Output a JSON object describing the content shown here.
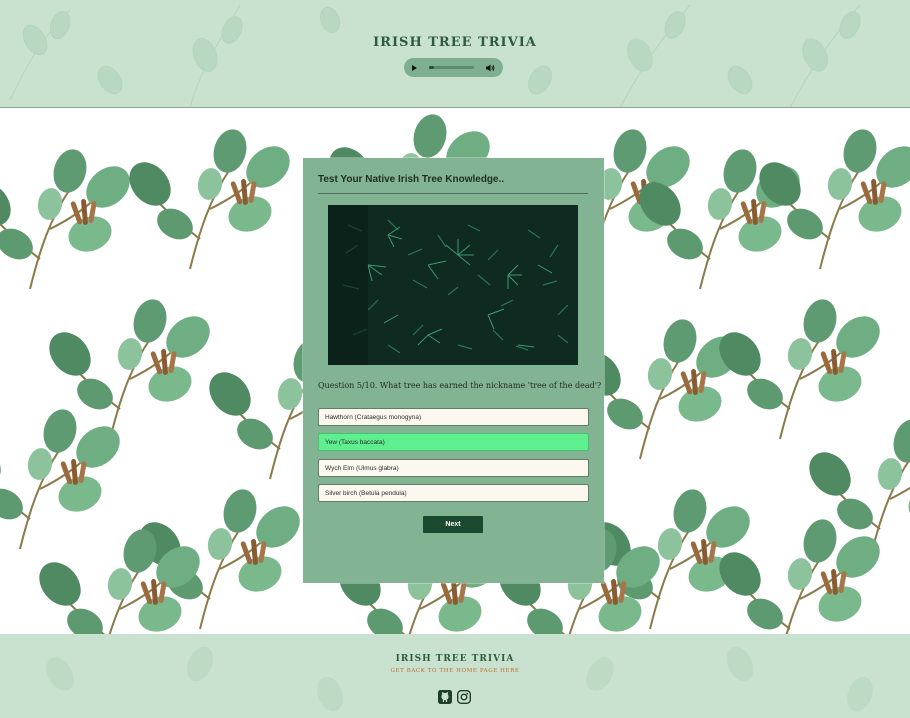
{
  "header": {
    "title": "IRISH TREE TRIVIA",
    "audio": {
      "progress": 0.12
    }
  },
  "quiz": {
    "heading": "Test Your Native Irish Tree Knowledge..",
    "question": "Question 5/10. What tree has earned the nickname 'tree of the dead'?",
    "answers": [
      {
        "label": "Hawthorn (Crataegus monogyna)",
        "state": "default"
      },
      {
        "label": "Yew (Taxus baccata)",
        "state": "correct"
      },
      {
        "label": "Wych Elm (Ulmus glabra)",
        "state": "default"
      },
      {
        "label": "Silver birch (Betula pendula)",
        "state": "default"
      }
    ],
    "next_label": "Next"
  },
  "footer": {
    "title": "IRISH TREE TRIVIA",
    "link": "GET BACK TO THE HOME PAGE HERE",
    "icons": [
      "github-icon",
      "instagram-icon"
    ]
  },
  "colors": {
    "header_bg": "#c8e2cf",
    "card_bg": "#82b392",
    "correct": "#5ef08f",
    "button": "#1c4a31",
    "link": "#c06a2b"
  }
}
